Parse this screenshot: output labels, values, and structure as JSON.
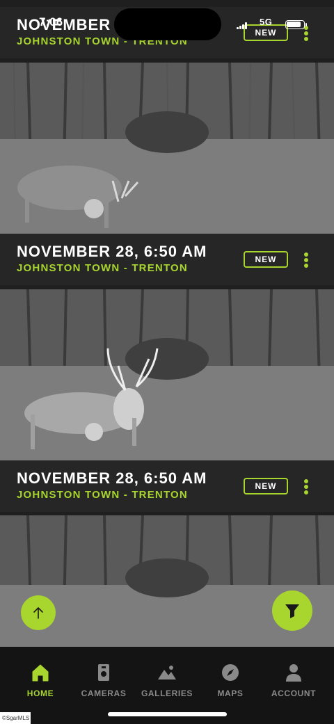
{
  "status_bar": {
    "time": "7:06",
    "network": "5G"
  },
  "cards": [
    {
      "date": "NOVEMBER 28, 6:50 AM",
      "location": "JOHNSTON TOWN - TRENTON",
      "badge": "NEW"
    },
    {
      "date": "NOVEMBER 28, 6:50 AM",
      "location": "JOHNSTON TOWN - TRENTON",
      "badge": "NEW"
    },
    {
      "date": "NOVEMBER 28, 6:50 AM",
      "location": "JOHNSTON TOWN - TRENTON",
      "badge": "NEW"
    }
  ],
  "nav": {
    "items": [
      {
        "label": "HOME",
        "icon": "home-icon",
        "active": true
      },
      {
        "label": "CAMERAS",
        "icon": "camera-icon",
        "active": false
      },
      {
        "label": "GALLERIES",
        "icon": "gallery-icon",
        "active": false
      },
      {
        "label": "MAPS",
        "icon": "compass-icon",
        "active": false
      },
      {
        "label": "ACCOUNT",
        "icon": "account-icon",
        "active": false
      }
    ]
  },
  "watermark": "©SgarMLS",
  "colors": {
    "accent": "#a8d52e",
    "header_bg": "#262626",
    "nav_bg": "#141414",
    "inactive": "#8a8a8a"
  }
}
